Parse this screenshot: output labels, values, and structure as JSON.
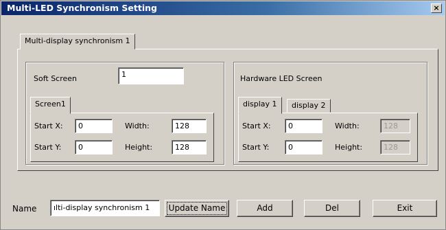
{
  "window": {
    "title": "Multi-LED Synchronism Setting",
    "close_label": "×"
  },
  "outer_tab": {
    "label": "Multi-display synchronism 1"
  },
  "soft": {
    "label": "Soft Screen",
    "value": "1",
    "tab": "Screen1",
    "start_x_label": "Start X:",
    "start_x": "0",
    "start_y_label": "Start Y:",
    "start_y": "0",
    "width_label": "Width:",
    "width": "128",
    "height_label": "Height:",
    "height": "128"
  },
  "hardware": {
    "label": "Hardware LED Screen",
    "tabs": [
      "display 1",
      "display 2"
    ],
    "start_x_label": "Start X:",
    "start_x": "0",
    "start_y_label": "Start Y:",
    "start_y": "0",
    "width_label": "Width:",
    "width": "128",
    "height_label": "Height:",
    "height": "128"
  },
  "footer": {
    "name_label": "Name",
    "name_value": "ılti-display synchronism 1",
    "update_label": "Update Name",
    "add_label": "Add",
    "del_label": "Del",
    "exit_label": "Exit"
  }
}
